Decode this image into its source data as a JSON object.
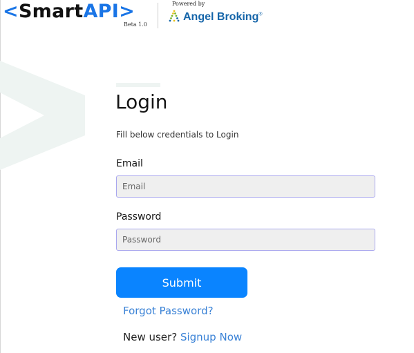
{
  "header": {
    "logo": {
      "bracket_open": "<",
      "smart": "Smart",
      "api": "API",
      "bracket_close": ">"
    },
    "beta": "Beta 1.0",
    "powered_by": "Powered by",
    "partner_name": "Angel Broking",
    "partner_registered": "®"
  },
  "login": {
    "title": "Login",
    "subtitle": "Fill below credentials to Login",
    "email_label": "Email",
    "email_placeholder": "Email",
    "password_label": "Password",
    "password_placeholder": "Password",
    "submit_label": "Submit",
    "forgot_label": "Forgot Password?",
    "new_user_text": "New user?",
    "signup_label": "Signup Now"
  },
  "colors": {
    "brand_blue": "#1a75e6",
    "submit_bg": "#0a84ff",
    "link": "#3a82d6",
    "input_border": "#a9a7ee",
    "input_bg": "#efefef",
    "angel_blue": "#1565a9",
    "angel_green": "#79b531",
    "angel_yellow": "#e8c21a",
    "decor_green": "#eef4f2"
  }
}
